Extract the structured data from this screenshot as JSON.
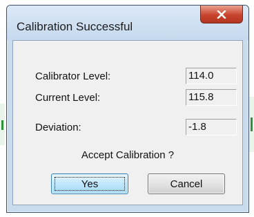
{
  "window": {
    "title": "Calibration Successful",
    "close_icon": "close-x-icon"
  },
  "fields": [
    {
      "label": "Calibrator Level:",
      "value": "114.0"
    },
    {
      "label": "Current Level:",
      "value": "115.8"
    },
    {
      "label": "Deviation:",
      "value": "-1.8"
    }
  ],
  "prompt": "Accept Calibration ?",
  "buttons": {
    "yes_label": "Yes",
    "cancel_label": "Cancel"
  },
  "colors": {
    "title_bar": "#c6d9ee",
    "close_button": "#c8452e",
    "client_bg": "#f0f0f0",
    "default_button": "#bee6fd"
  }
}
